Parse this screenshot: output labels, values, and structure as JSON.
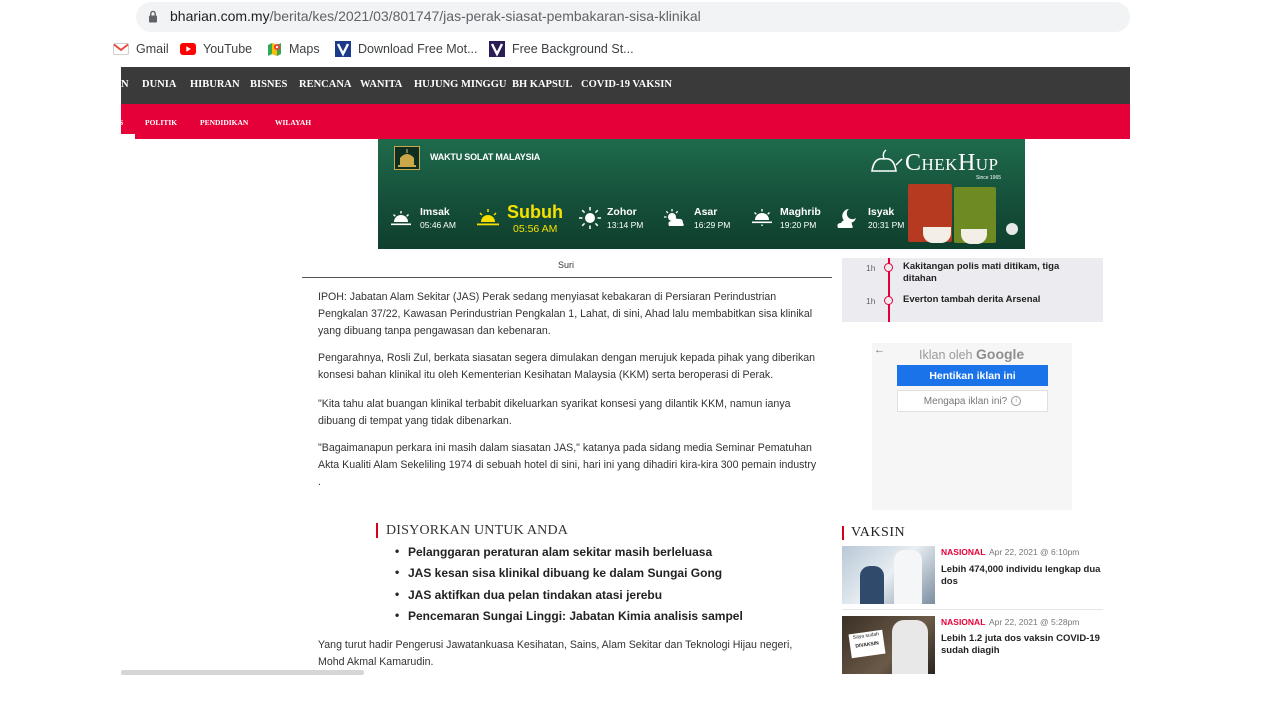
{
  "browser": {
    "url_host": "bharian.com.my",
    "url_path": "/berita/kes/2021/03/801747/jas-perak-siasat-pembakaran-sisa-klinikal",
    "bookmarks": [
      {
        "label": "Gmail",
        "icon": "gmail-icon"
      },
      {
        "label": "YouTube",
        "icon": "youtube-icon"
      },
      {
        "label": "Maps",
        "icon": "maps-icon"
      },
      {
        "label": "Download Free Mot...",
        "icon": "v-bookmark-icon"
      },
      {
        "label": "Free Background St...",
        "icon": "v-bookmark-icon"
      }
    ]
  },
  "nav": {
    "top_items": [
      "N",
      "DUNIA",
      "HIBURAN",
      "BISNES",
      "RENCANA",
      "WANITA",
      "HUJUNG MINGGU",
      "BH KAPSUL",
      "COVID-19 VAKSIN"
    ],
    "sub_items": [
      "S",
      "POLITIK",
      "PENDIDIKAN",
      "WILAYAH"
    ]
  },
  "banner": {
    "title": "WAKTU SOLAT MALAYSIA",
    "brand": "ChekHup",
    "brand_since": "Since 1965",
    "prayers": [
      {
        "name": "Imsak",
        "time": "05:46 AM"
      },
      {
        "name": "Subuh",
        "time": "05:56 AM"
      },
      {
        "name": "Zohor",
        "time": "13:14 PM"
      },
      {
        "name": "Asar",
        "time": "16:29 PM"
      },
      {
        "name": "Maghrib",
        "time": "19:20 PM"
      },
      {
        "name": "Isyak",
        "time": "20:31 PM"
      }
    ],
    "highlight_color": "#f5e000"
  },
  "article": {
    "image_caption": "Suri",
    "paragraphs": [
      "IPOH: Jabatan Alam Sekitar (JAS) Perak sedang menyiasat kebakaran di Persiaran Perindustrian Pengkalan 37/22, Kawasan Perindustrian Pengkalan 1, Lahat, di sini, Ahad lalu membabitkan sisa klinikal yang dibuang tanpa pengawasan dan kebenaran.",
      "Pengarahnya, Rosli Zul, berkata siasatan segera dimulakan dengan merujuk kepada pihak yang diberikan konsesi bahan klinikal itu oleh Kementerian Kesihatan Malaysia (KKM) serta beroperasi di Perak.",
      "\"Kita tahu alat buangan klinikal terbabit dikeluarkan syarikat konsesi yang dilantik KKM, namun ianya dibuang di tempat yang tidak dibenarkan.",
      "\"Bagaimanapun perkara ini masih dalam siasatan JAS,\" katanya pada sidang media Seminar Pematuhan Akta Kualiti Alam Sekeliling 1974 di sebuah hotel di sini, hari ini yang dihadiri kira-kira 300 pemain industry ."
    ],
    "recommended_title": "DISYORKAN UNTUK ANDA",
    "recommended": [
      "Pelanggaran peraturan alam sekitar masih berleluasa",
      "JAS kesan sisa klinikal dibuang ke dalam Sungai Gong",
      "JAS aktifkan dua pelan tindakan atasi jerebu",
      "Pencemaran Sungai Linggi: Jabatan Kimia analisis sampel"
    ],
    "closing": "Yang turut hadir Pengerusi Jawatankuasa Kesihatan, Sains, Alam Sekitar dan Teknologi Hijau negeri, Mohd Akmal Kamarudin."
  },
  "timeline": [
    {
      "time": "1h",
      "text": "Kakitangan polis mati ditikam, tiga ditahan"
    },
    {
      "time": "1h",
      "text": "Everton tambah derita Arsenal"
    }
  ],
  "ad": {
    "label_prefix": "Iklan oleh",
    "label_brand": "Google",
    "stop_label": "Hentikan iklan ini",
    "why_label": "Mengapa iklan ini?",
    "back": "←",
    "info": "i"
  },
  "vaksin": {
    "title": "VAKSIN",
    "items": [
      {
        "category": "NASIONAL",
        "date": "Apr 22, 2021 @ 6:10pm",
        "headline": "Lebih 474,000 individu lengkap dua dos"
      },
      {
        "category": "NASIONAL",
        "date": "Apr 22, 2021 @ 5:28pm",
        "headline": "Lebih 1.2 juta dos vaksin COVID-19 sudah diagih"
      }
    ],
    "placard_line1": "Saya sudah",
    "placard_line2": "DIVAKSIN"
  },
  "colors": {
    "nav_bg": "#3a3a3a",
    "accent_red": "#e5003a",
    "google_blue": "#1a73e8"
  }
}
